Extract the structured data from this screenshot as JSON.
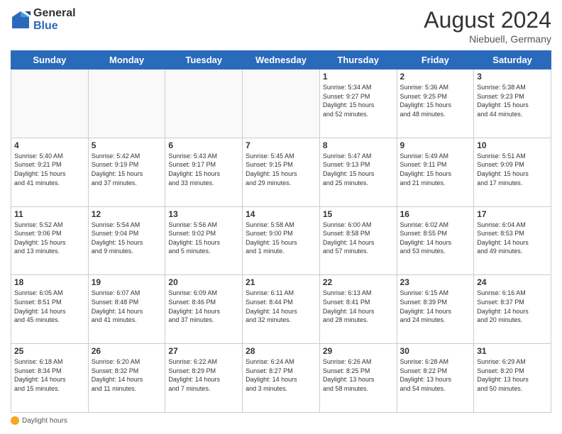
{
  "header": {
    "logo_general": "General",
    "logo_blue": "Blue",
    "month_year": "August 2024",
    "location": "Niebuell, Germany"
  },
  "days_of_week": [
    "Sunday",
    "Monday",
    "Tuesday",
    "Wednesday",
    "Thursday",
    "Friday",
    "Saturday"
  ],
  "weeks": [
    [
      {
        "day": "",
        "info": ""
      },
      {
        "day": "",
        "info": ""
      },
      {
        "day": "",
        "info": ""
      },
      {
        "day": "",
        "info": ""
      },
      {
        "day": "1",
        "info": "Sunrise: 5:34 AM\nSunset: 9:27 PM\nDaylight: 15 hours\nand 52 minutes."
      },
      {
        "day": "2",
        "info": "Sunrise: 5:36 AM\nSunset: 9:25 PM\nDaylight: 15 hours\nand 48 minutes."
      },
      {
        "day": "3",
        "info": "Sunrise: 5:38 AM\nSunset: 9:23 PM\nDaylight: 15 hours\nand 44 minutes."
      }
    ],
    [
      {
        "day": "4",
        "info": "Sunrise: 5:40 AM\nSunset: 9:21 PM\nDaylight: 15 hours\nand 41 minutes."
      },
      {
        "day": "5",
        "info": "Sunrise: 5:42 AM\nSunset: 9:19 PM\nDaylight: 15 hours\nand 37 minutes."
      },
      {
        "day": "6",
        "info": "Sunrise: 5:43 AM\nSunset: 9:17 PM\nDaylight: 15 hours\nand 33 minutes."
      },
      {
        "day": "7",
        "info": "Sunrise: 5:45 AM\nSunset: 9:15 PM\nDaylight: 15 hours\nand 29 minutes."
      },
      {
        "day": "8",
        "info": "Sunrise: 5:47 AM\nSunset: 9:13 PM\nDaylight: 15 hours\nand 25 minutes."
      },
      {
        "day": "9",
        "info": "Sunrise: 5:49 AM\nSunset: 9:11 PM\nDaylight: 15 hours\nand 21 minutes."
      },
      {
        "day": "10",
        "info": "Sunrise: 5:51 AM\nSunset: 9:09 PM\nDaylight: 15 hours\nand 17 minutes."
      }
    ],
    [
      {
        "day": "11",
        "info": "Sunrise: 5:52 AM\nSunset: 9:06 PM\nDaylight: 15 hours\nand 13 minutes."
      },
      {
        "day": "12",
        "info": "Sunrise: 5:54 AM\nSunset: 9:04 PM\nDaylight: 15 hours\nand 9 minutes."
      },
      {
        "day": "13",
        "info": "Sunrise: 5:56 AM\nSunset: 9:02 PM\nDaylight: 15 hours\nand 5 minutes."
      },
      {
        "day": "14",
        "info": "Sunrise: 5:58 AM\nSunset: 9:00 PM\nDaylight: 15 hours\nand 1 minute."
      },
      {
        "day": "15",
        "info": "Sunrise: 6:00 AM\nSunset: 8:58 PM\nDaylight: 14 hours\nand 57 minutes."
      },
      {
        "day": "16",
        "info": "Sunrise: 6:02 AM\nSunset: 8:55 PM\nDaylight: 14 hours\nand 53 minutes."
      },
      {
        "day": "17",
        "info": "Sunrise: 6:04 AM\nSunset: 8:53 PM\nDaylight: 14 hours\nand 49 minutes."
      }
    ],
    [
      {
        "day": "18",
        "info": "Sunrise: 6:05 AM\nSunset: 8:51 PM\nDaylight: 14 hours\nand 45 minutes."
      },
      {
        "day": "19",
        "info": "Sunrise: 6:07 AM\nSunset: 8:48 PM\nDaylight: 14 hours\nand 41 minutes."
      },
      {
        "day": "20",
        "info": "Sunrise: 6:09 AM\nSunset: 8:46 PM\nDaylight: 14 hours\nand 37 minutes."
      },
      {
        "day": "21",
        "info": "Sunrise: 6:11 AM\nSunset: 8:44 PM\nDaylight: 14 hours\nand 32 minutes."
      },
      {
        "day": "22",
        "info": "Sunrise: 6:13 AM\nSunset: 8:41 PM\nDaylight: 14 hours\nand 28 minutes."
      },
      {
        "day": "23",
        "info": "Sunrise: 6:15 AM\nSunset: 8:39 PM\nDaylight: 14 hours\nand 24 minutes."
      },
      {
        "day": "24",
        "info": "Sunrise: 6:16 AM\nSunset: 8:37 PM\nDaylight: 14 hours\nand 20 minutes."
      }
    ],
    [
      {
        "day": "25",
        "info": "Sunrise: 6:18 AM\nSunset: 8:34 PM\nDaylight: 14 hours\nand 15 minutes."
      },
      {
        "day": "26",
        "info": "Sunrise: 6:20 AM\nSunset: 8:32 PM\nDaylight: 14 hours\nand 11 minutes."
      },
      {
        "day": "27",
        "info": "Sunrise: 6:22 AM\nSunset: 8:29 PM\nDaylight: 14 hours\nand 7 minutes."
      },
      {
        "day": "28",
        "info": "Sunrise: 6:24 AM\nSunset: 8:27 PM\nDaylight: 14 hours\nand 3 minutes."
      },
      {
        "day": "29",
        "info": "Sunrise: 6:26 AM\nSunset: 8:25 PM\nDaylight: 13 hours\nand 58 minutes."
      },
      {
        "day": "30",
        "info": "Sunrise: 6:28 AM\nSunset: 8:22 PM\nDaylight: 13 hours\nand 54 minutes."
      },
      {
        "day": "31",
        "info": "Sunrise: 6:29 AM\nSunset: 8:20 PM\nDaylight: 13 hours\nand 50 minutes."
      }
    ]
  ],
  "footer": {
    "daylight_label": "Daylight hours"
  }
}
